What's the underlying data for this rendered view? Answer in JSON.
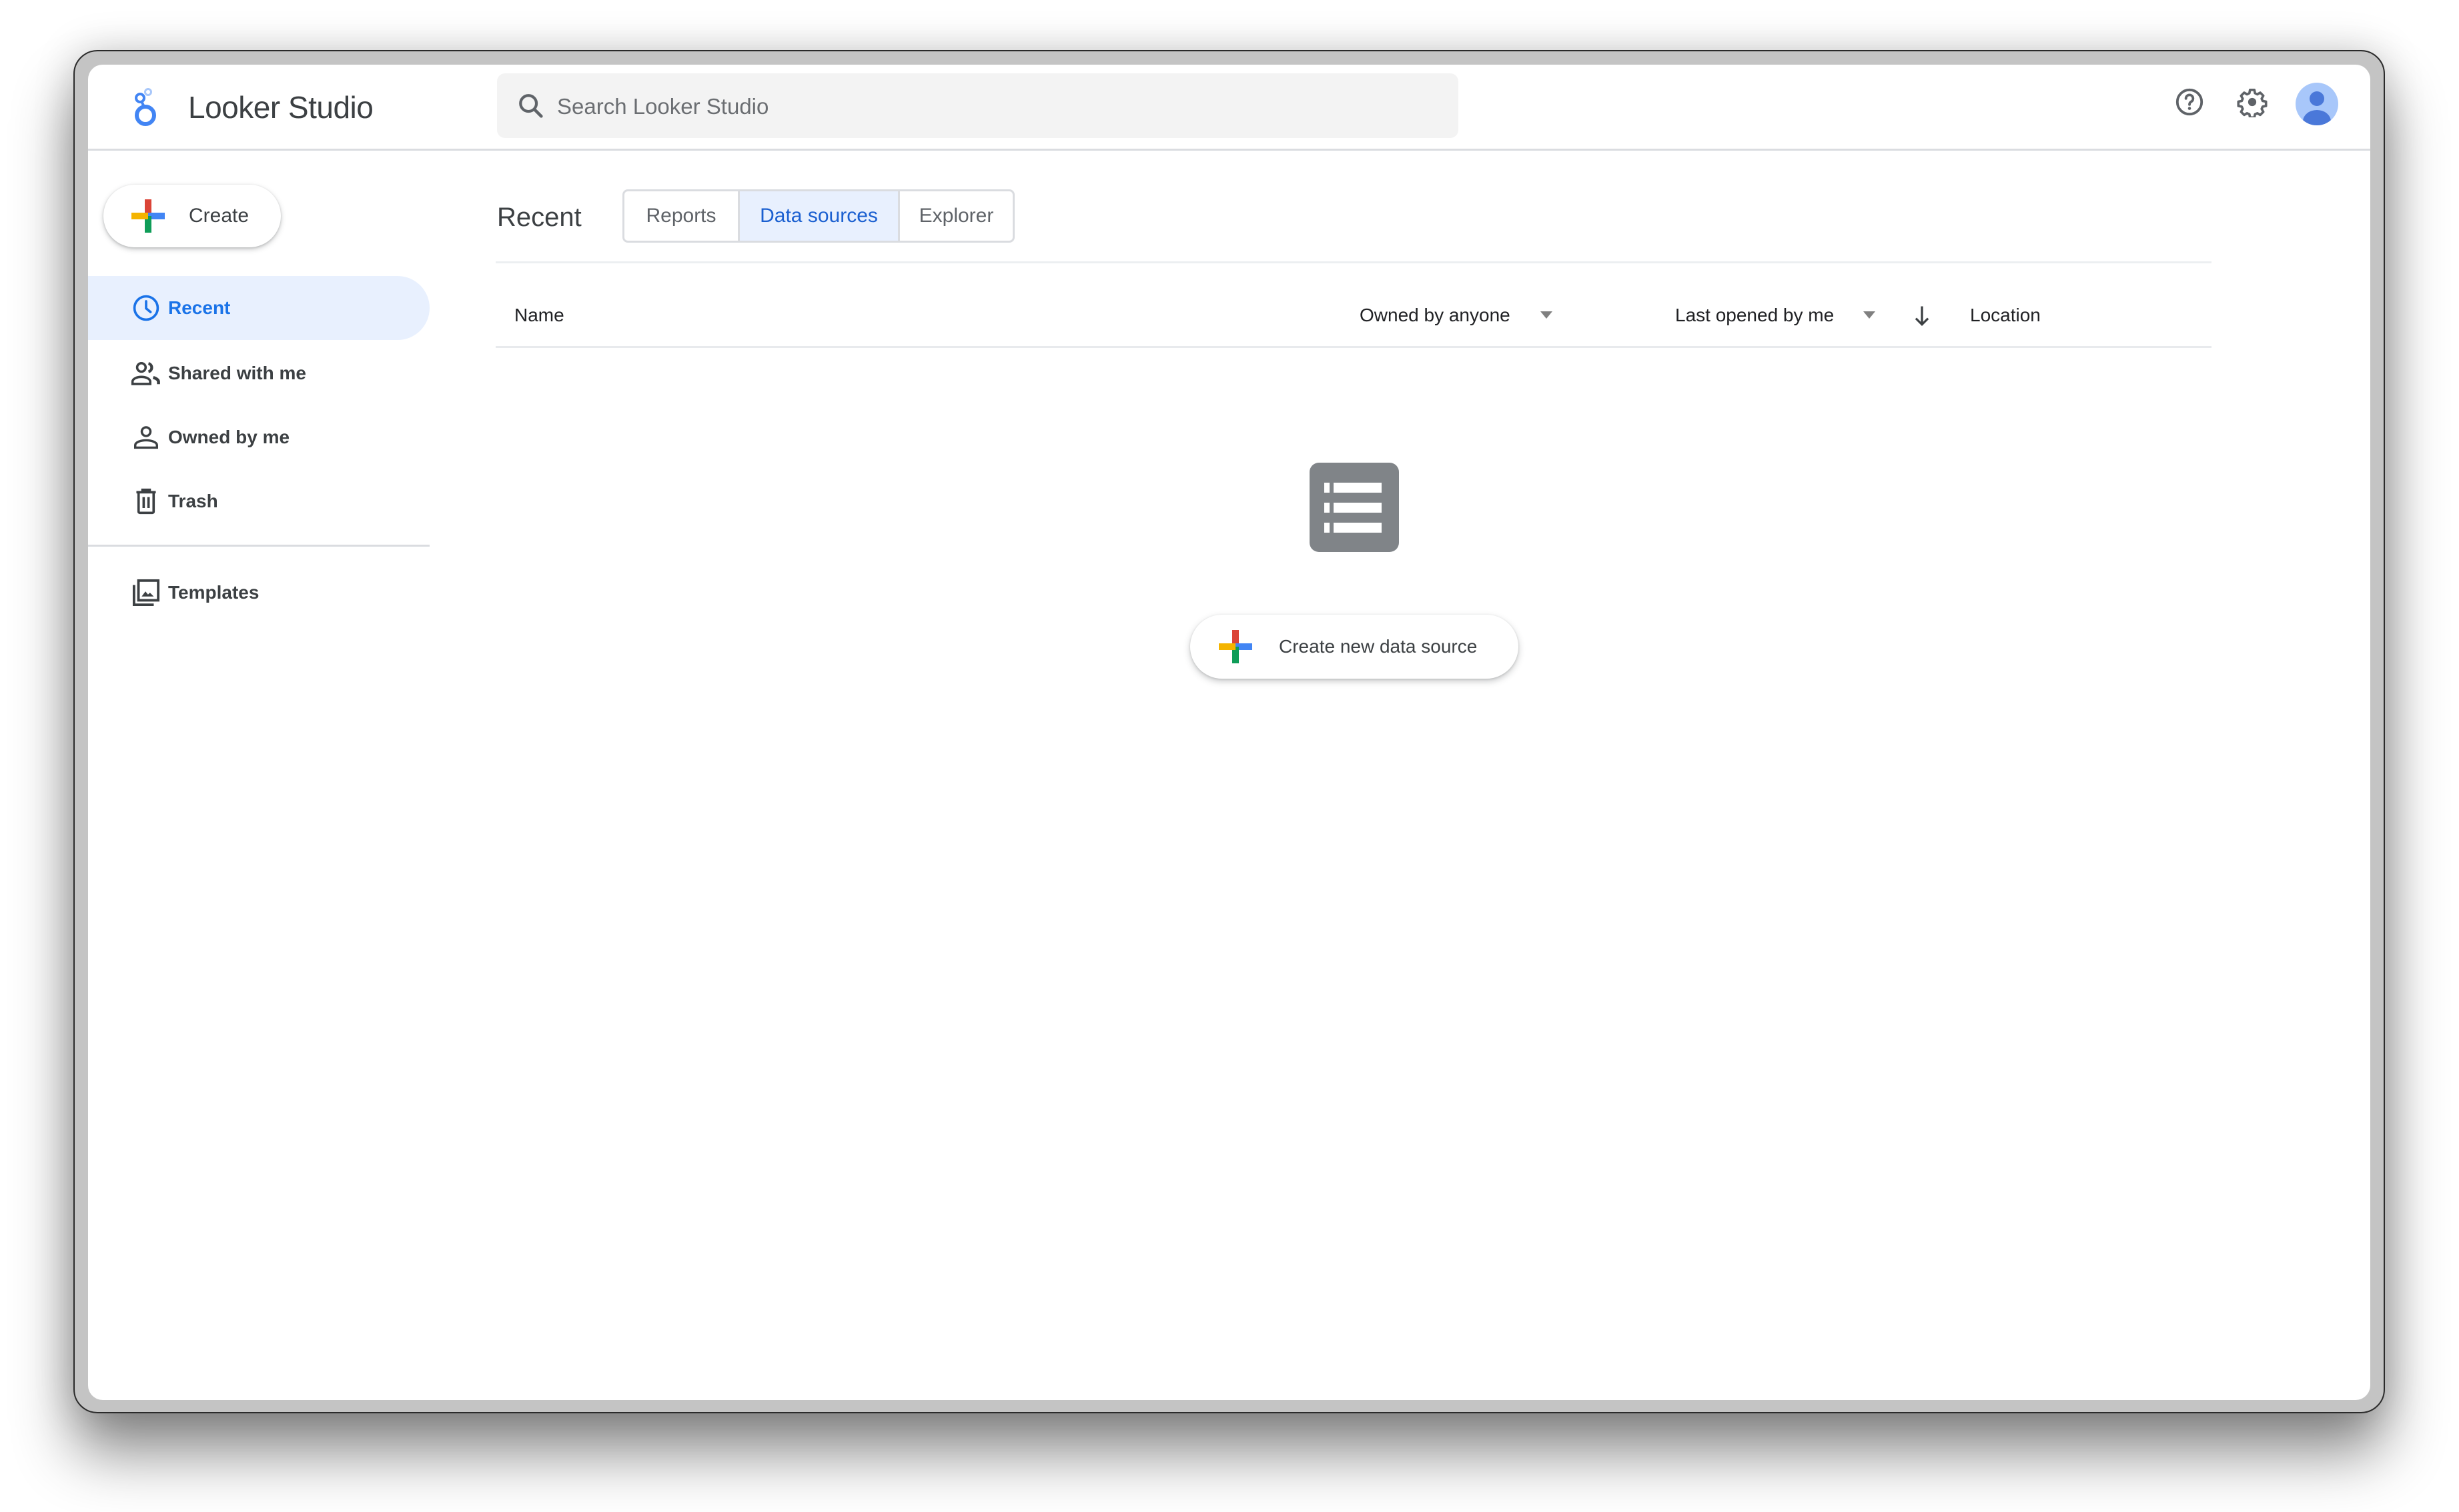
{
  "app": {
    "title": "Looker Studio",
    "brand_color": "#4285f4"
  },
  "search": {
    "placeholder": "Search Looker Studio",
    "value": ""
  },
  "header_actions": {
    "help_icon": "help-circle-icon",
    "settings_icon": "gear-icon",
    "avatar_icon": "account-avatar-icon"
  },
  "sidebar": {
    "create_label": "Create",
    "items": [
      {
        "label": "Recent",
        "icon": "clock-icon",
        "active": true
      },
      {
        "label": "Shared with me",
        "icon": "people-icon",
        "active": false
      },
      {
        "label": "Owned by me",
        "icon": "person-icon",
        "active": false
      },
      {
        "label": "Trash",
        "icon": "trash-icon",
        "active": false
      },
      {
        "label": "Templates",
        "icon": "templates-icon",
        "active": false
      }
    ]
  },
  "main": {
    "section_title": "Recent",
    "tabs": [
      {
        "label": "Reports",
        "active": false
      },
      {
        "label": "Data sources",
        "active": true
      },
      {
        "label": "Explorer",
        "active": false
      }
    ],
    "columns": {
      "name": "Name",
      "owner": "Owned by anyone",
      "last_opened": "Last opened by me",
      "location": "Location"
    },
    "empty_state": {
      "icon": "list-icon",
      "button_label": "Create new data source"
    }
  },
  "colors": {
    "accent": "#1a73e8",
    "active_bg": "#e8f0fe",
    "google_red": "#db4437",
    "google_yellow": "#f4b400",
    "google_green": "#0f9d58",
    "google_blue": "#4285f4"
  }
}
